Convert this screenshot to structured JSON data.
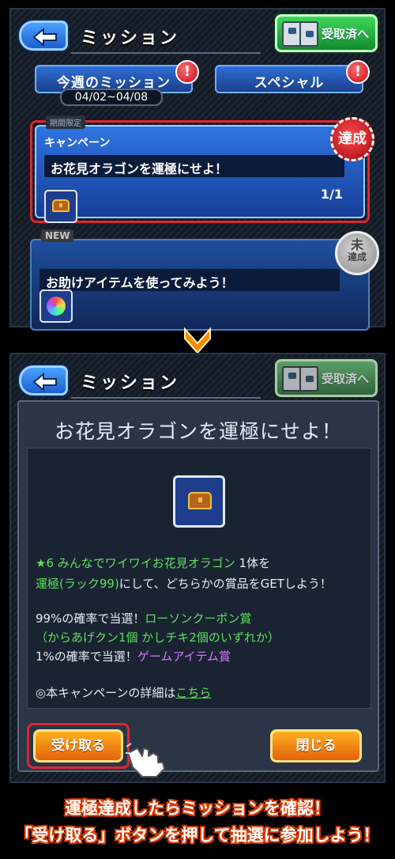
{
  "top_screen": {
    "header": {
      "title": "ミッション",
      "received_button": "受取済へ"
    },
    "tabs": [
      {
        "label": "今週のミッション",
        "date_range": "04/02~04/08",
        "alert": "!"
      },
      {
        "label": "スペシャル",
        "alert": "!"
      }
    ],
    "missions": [
      {
        "tag": "期間限定",
        "category": "キャンペーン",
        "title": "お花見オラゴンを運極にせよ！",
        "progress": "1/1",
        "stamp": "達成",
        "reward_icon": "treasure-chest-icon"
      },
      {
        "tag": "NEW",
        "title": "お助けアイテムを使ってみよう！",
        "stamp_top": "未",
        "stamp_bottom": "達成",
        "reward_icon": "rainbow-orb-icon"
      }
    ]
  },
  "bottom_screen": {
    "header": {
      "title": "ミッション",
      "received_button": "受取済へ"
    },
    "dialog": {
      "title": "お花見オラゴンを運極にせよ！",
      "reward_icon": "treasure-chest-icon",
      "line1_highlight": "★6 みんなでワイワイお花見オラゴン",
      "line1_rest": " 1体を",
      "line2_highlight": "運極(ラック99)",
      "line2_rest": "にして、どちらかの賞品をGETしよう！",
      "line3_prefix": "99%の確率で当選！",
      "line3_highlight": "ローソンクーポン賞",
      "line4": "（からあげクン1個 かしチキ2個のいずれか）",
      "line5_prefix": "1%の確率で当選！",
      "line5_highlight": "ゲームアイテム賞",
      "line6_prefix": "◎本キャンペーンの詳細は",
      "line6_link": "こちら",
      "receive_button": "受け取る",
      "close_button": "閉じる"
    }
  },
  "captions": [
    "運極達成したらミッションを確認！",
    "「受け取る」ボタンを押して抽選に参加しよう！"
  ],
  "colors": {
    "accent_blue": "#2f74e2",
    "highlight_red": "#e0262e",
    "button_orange": "#ffb020",
    "text_green": "#5ee05e",
    "text_purple": "#d77bff"
  }
}
